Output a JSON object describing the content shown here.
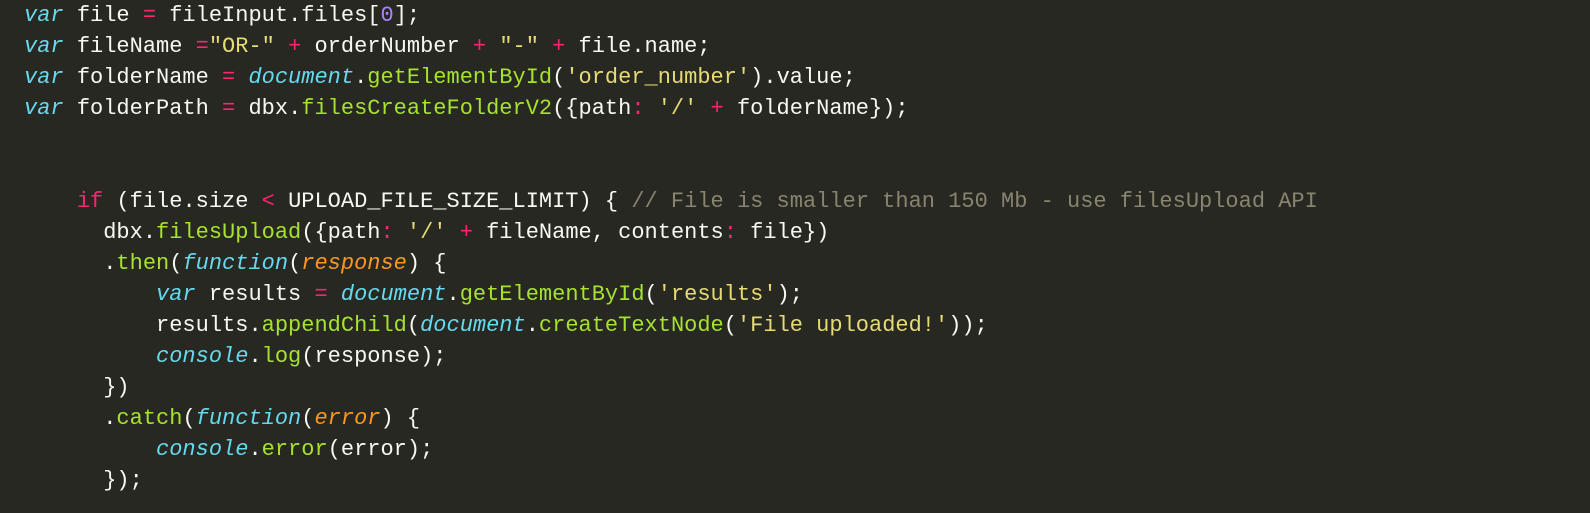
{
  "tokens": {
    "kw_var": "var",
    "kw_if": "if",
    "kw_func": "function",
    "id_file": "file",
    "id_fileInput": "fileInput",
    "id_files": "files",
    "num_0": "0",
    "id_fileName": "fileName",
    "str_ORdash": "\"OR-\"",
    "id_orderNumber": "orderNumber",
    "str_dash": "\"-\"",
    "id_name": "name",
    "id_folderName": "folderName",
    "obj_document": "document",
    "fn_getElementById": "getElementById",
    "str_order_number": "'order_number'",
    "id_value": "value",
    "id_folderPath": "folderPath",
    "id_dbx": "dbx",
    "fn_filesCreateFolderV2": "filesCreateFolderV2",
    "id_path": "path",
    "str_slash": "'/'",
    "id_size": "size",
    "id_UPLOAD_LIMIT": "UPLOAD_FILE_SIZE_LIMIT",
    "cm_small": "// File is smaller than 150 Mb - use filesUpload API",
    "fn_filesUpload": "filesUpload",
    "id_contents": "contents",
    "fn_then": "then",
    "prm_response": "response",
    "id_results": "results",
    "str_results": "'results'",
    "fn_appendChild": "appendChild",
    "fn_createTextNode": "createTextNode",
    "str_uploaded": "'File uploaded!'",
    "obj_console": "console",
    "fn_log": "log",
    "fn_catch": "catch",
    "prm_error": "error",
    "fn_error": "error"
  }
}
